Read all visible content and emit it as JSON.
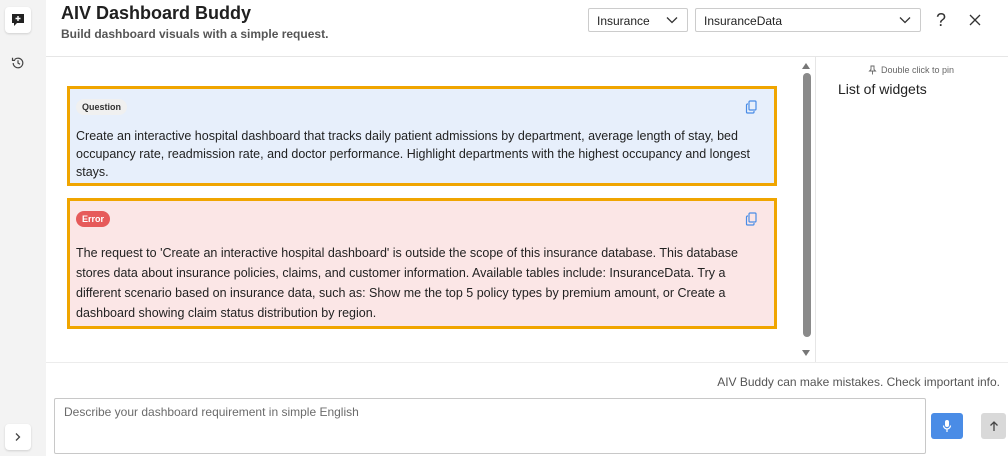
{
  "header": {
    "title": "AIV Dashboard Buddy",
    "subtitle": "Build dashboard visuals with a simple request.",
    "category_select": "Insurance",
    "dataset_select": "InsuranceData",
    "help_label": "?"
  },
  "chat": {
    "question": {
      "badge": "Question",
      "text": "Create an interactive hospital dashboard that tracks daily patient admissions by department, average length of stay, bed occupancy rate, readmission rate, and doctor performance. Highlight departments with the highest occupancy and longest stays."
    },
    "error": {
      "badge": "Error",
      "text": "The request to 'Create an interactive hospital dashboard' is outside the scope of this insurance database. This database stores data about insurance policies, claims, and customer information. Available tables include: InsuranceData. Try a different scenario based on insurance data, such as: Show me the top 5 policy types by premium amount, or Create a dashboard showing claim status distribution by region."
    }
  },
  "widgets": {
    "pin_hint": "Double click to pin",
    "title": "List of widgets"
  },
  "footer": {
    "disclaimer": "AIV Buddy can make mistakes. Check important info.",
    "input_placeholder": "Describe your dashboard requirement in simple English"
  },
  "colors": {
    "highlight_border": "#f0a500",
    "question_bg": "#e7effb",
    "error_bg": "#fbe6e6",
    "error_badge": "#e65a5a",
    "mic_button": "#4a8ce6"
  }
}
